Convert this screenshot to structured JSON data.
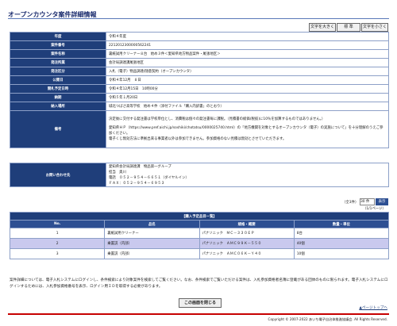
{
  "title": "オープンカウンタ案件詳細情報",
  "font_buttons": {
    "large": "文字を大きく",
    "standard": "標 準",
    "small": "文字を小さく"
  },
  "detail": [
    {
      "label": "年度",
      "value": "令和４年度"
    },
    {
      "label": "案件番号",
      "value": "2212012300000562241"
    },
    {
      "label": "案件名称",
      "value": "裏紙試用クリーナー８台　始め３件＜愛知県地方物品案件・尾張地区＞"
    },
    {
      "label": "発注所属",
      "value": "会計局調達課尾張地区"
    },
    {
      "label": "発注区分",
      "value": "入札（電子）物品調達/随意契約（オープンカウンタ）"
    },
    {
      "label": "公開日",
      "value": "令和４年12月　８日"
    },
    {
      "label": "開札予定日時",
      "value": "令和４年12月15日　10時00分"
    },
    {
      "label": "納期",
      "value": "令和５年１月20日"
    },
    {
      "label": "納入場所",
      "value": "城北つばさ高等学校　始め４件（添付ファイル「購入内訳書」のとおり）"
    }
  ],
  "remarks": {
    "label": "備考",
    "lines": [
      "決定後に交付する発注書は学校単位とし、消費税は個々の発注書毎に課税。（見積書の総価(税抜)に10％を加算するものではありません。）",
      "愛知県ＨＰ（https://www.pref.aichi.jp/soshiki/chotatsu/0000025740.html）の「地方機関を対象とするオープンカウンタ（電子）の実施について」を十分理解のうえご参加ください。",
      "電子くじ無効方法に準拠出来る事業者以外は参加できません。参加資格のない見積は無効とさせていただきます。"
    ]
  },
  "contact": {
    "label": "お問い合わせ先",
    "lines": [
      "愛知県会計局調達課　物品第一グループ",
      "担当　奥川",
      "電話　０５２－９５４－６６５１（ダイヤルイン）",
      "ＦＡＸ：０５２－９５４－６９５３"
    ]
  },
  "pager": {
    "total": "（全3件）",
    "per_page": "30 件",
    "go": "表示",
    "page": "（1/1ページ）"
  },
  "items": {
    "caption": "【購入予定品目一覧】",
    "headers": [
      "No.",
      "品名",
      "規格・概要",
      "数量・単位"
    ],
    "rows": [
      [
        "1",
        "裏紙試用クリーナー",
        "パナソニック　ＭＣ－３３０ＥＰ",
        "8台"
      ],
      [
        "2",
        "乗置説（内部）",
        "パナソニック　ＡＭＣ９９Ｋ－５５０",
        "40個"
      ],
      [
        "3",
        "乗置説（内部）",
        "パナソニック　ＡＭＣ０６Ｋ－Ｙ４０",
        "10個"
      ]
    ]
  },
  "notice": "案件詳細については、電子入札システムにログインし、条件検索により対象案件を検索してご覧ください。なお、条件検索でご覧いただける案件は、入札参加資格者名簿に登載がある団体のものに限られます。電子入札システムにログインするためには、入札参加資格番号を表示、ログイン用ＩＤを取得する必要があります。",
  "close_button": "この画面を閉じる",
  "page_top": "▲ページトップへ",
  "copyright": "Copyright © 2007-2022 あいち電子自治体推進協議会. All Rights Reserved."
}
